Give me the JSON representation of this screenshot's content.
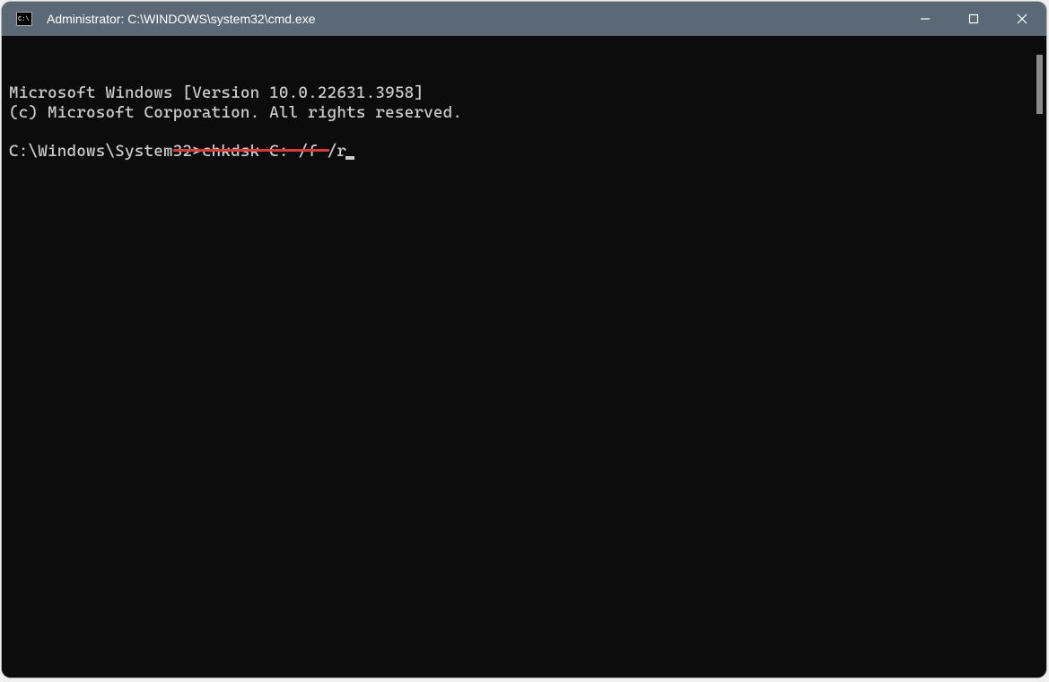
{
  "window": {
    "title": "Administrator: C:\\WINDOWS\\system32\\cmd.exe"
  },
  "terminal": {
    "line1": "Microsoft Windows [Version 10.0.22631.3958]",
    "line2": "(c) Microsoft Corporation. All rights reserved.",
    "prompt": "C:\\Windows\\System32>",
    "command": "chkdsk C: /f /r"
  }
}
